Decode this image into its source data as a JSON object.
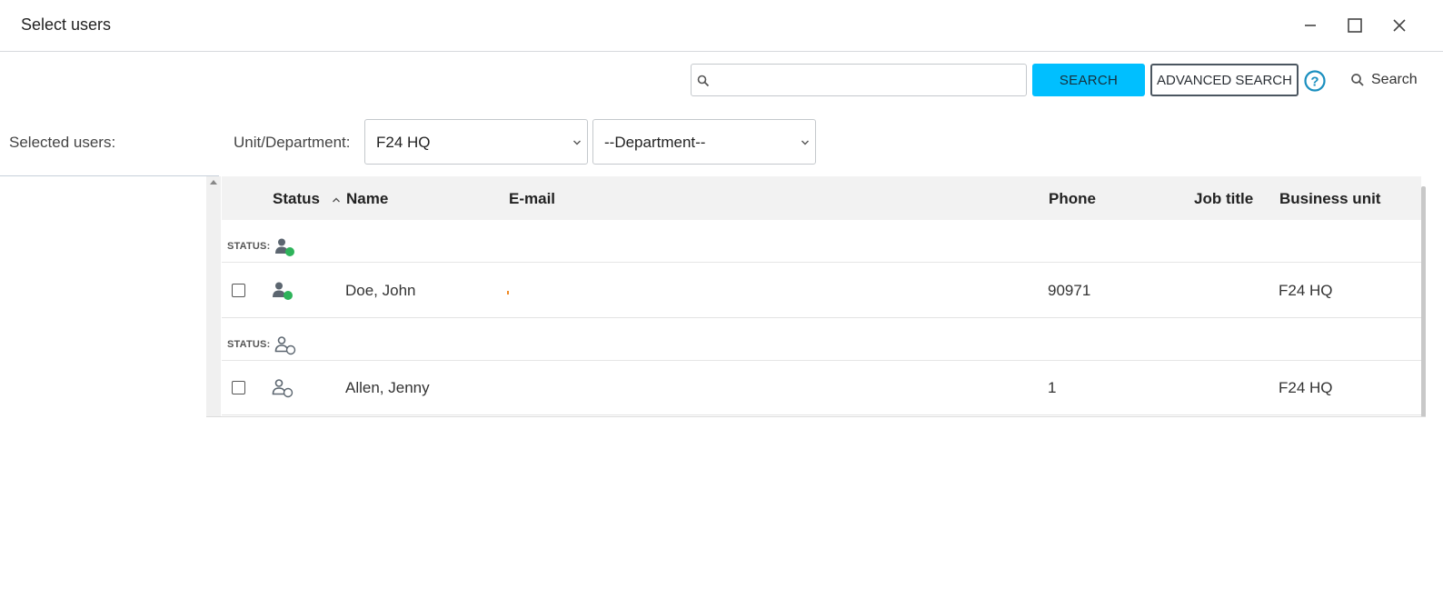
{
  "window": {
    "title": "Select users"
  },
  "toolbar": {
    "search_placeholder": "",
    "search_button": "SEARCH",
    "advanced_search_button": "ADVANCED SEARCH",
    "search_link": "Search",
    "accent_color": "#00bfff"
  },
  "filters": {
    "selected_users_label": "Selected users:",
    "unit_label": "Unit/Department:",
    "unit_value": "F24 HQ",
    "department_value": "--Department--"
  },
  "grid": {
    "columns": [
      "Status",
      "Name",
      "E-mail",
      "Phone",
      "Job title",
      "Business unit"
    ],
    "sorted_column": "Status",
    "sort_direction": "ascending",
    "groups": [
      {
        "label": "STATUS:",
        "status_icon": "user-online-icon",
        "rows": [
          {
            "name": "Doe, John",
            "email": "",
            "phone": "90971",
            "job_title": "",
            "business_unit": "F24 HQ"
          }
        ]
      },
      {
        "label": "STATUS:",
        "status_icon": "user-offline-icon",
        "rows": [
          {
            "name": "Allen, Jenny",
            "email": "",
            "phone": "1",
            "job_title": "",
            "business_unit": "F24 HQ"
          }
        ]
      }
    ]
  },
  "colors": {
    "online": "#2eb35a",
    "help": "#1a8fbf"
  }
}
